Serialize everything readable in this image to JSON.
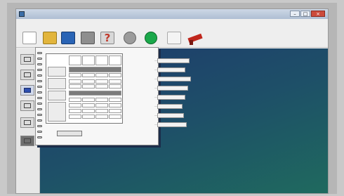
{
  "window": {
    "title": "",
    "menu": [
      "",
      "",
      "",
      "",
      "",
      "",
      "",
      "",
      ""
    ],
    "controls": {
      "minimize": "–",
      "maximize": "□",
      "close": "×"
    }
  },
  "toolbar": {
    "icons": [
      "new-document-icon",
      "open-folder-icon",
      "save-disk-icon",
      "print-icon",
      "help-icon",
      "stop-circle-icon",
      "go-circle-icon",
      "page-icon",
      "tool-icon"
    ],
    "help_glyph": "?"
  },
  "sidebar": {
    "icons": [
      "select-tool-icon",
      "layout-tool-icon",
      "chart-tool-icon",
      "grid-tool-icon",
      "zoom-tool-icon",
      "builder-tool-icon"
    ]
  },
  "colors": {
    "canvas_top": "#1d3a6d",
    "canvas_bottom": "#1f6a5e",
    "close_button": "#cc4b3c",
    "go_button": "#1aa84a",
    "tool_red": "#c0261c"
  },
  "status": ""
}
